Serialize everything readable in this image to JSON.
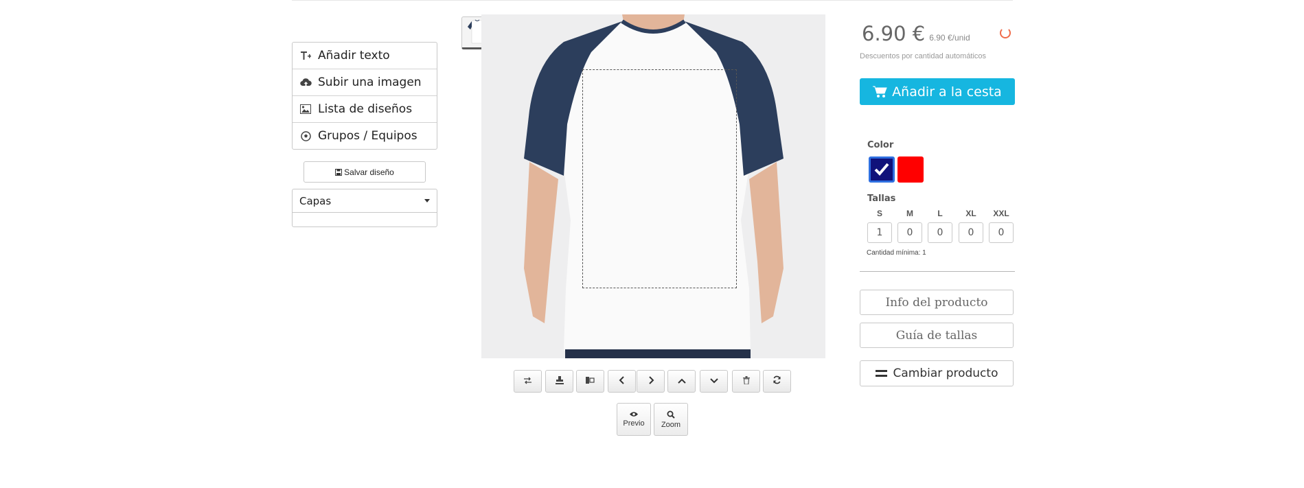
{
  "tools_menu": {
    "items": [
      {
        "label": "Añadir texto",
        "icon": "add-text-icon"
      },
      {
        "label": "Subir una imagen",
        "icon": "cloud-upload-icon"
      },
      {
        "label": "Lista de diseños",
        "icon": "image-icon"
      },
      {
        "label": "Grupos / Equipos",
        "icon": "soccer-ball-icon"
      }
    ],
    "save_label": "Salvar diseño",
    "layers_label": "Capas"
  },
  "product": {
    "views": [
      {
        "name": "front-view",
        "selected": true
      },
      {
        "name": "back-view",
        "selected": false
      }
    ],
    "colors": {
      "body": "#ffffff",
      "sleeves": "#2c3e5c"
    }
  },
  "toolbar": {
    "icons": [
      "swap-icon",
      "stamp-icon",
      "align-icon",
      "chevron-left-icon",
      "chevron-right-icon",
      "chevron-up-icon",
      "chevron-down-icon",
      "trash-icon",
      "refresh-icon"
    ],
    "preview_label": "Previo",
    "zoom_label": "Zoom"
  },
  "pricing": {
    "price": "6.90 €",
    "unit_price": "6.90 €/unid",
    "discount_note": "Descuentos por cantidad automáticos",
    "cart_label": "Añadir a la cesta"
  },
  "color_section": {
    "label": "Color",
    "swatches": [
      {
        "color": "#10127a",
        "selected": true
      },
      {
        "color": "#ff0000",
        "selected": false
      }
    ]
  },
  "sizes_section": {
    "label": "Tallas",
    "sizes": [
      {
        "size": "S",
        "qty": "1"
      },
      {
        "size": "M",
        "qty": "0"
      },
      {
        "size": "L",
        "qty": "0"
      },
      {
        "size": "XL",
        "qty": "0"
      },
      {
        "size": "XXL",
        "qty": "0"
      }
    ],
    "min_qty": "Cantidad mínima: 1"
  },
  "actions": {
    "info_label": "Info del producto",
    "guide_label": "Guía de tallas",
    "change_label": "Cambiar producto"
  }
}
